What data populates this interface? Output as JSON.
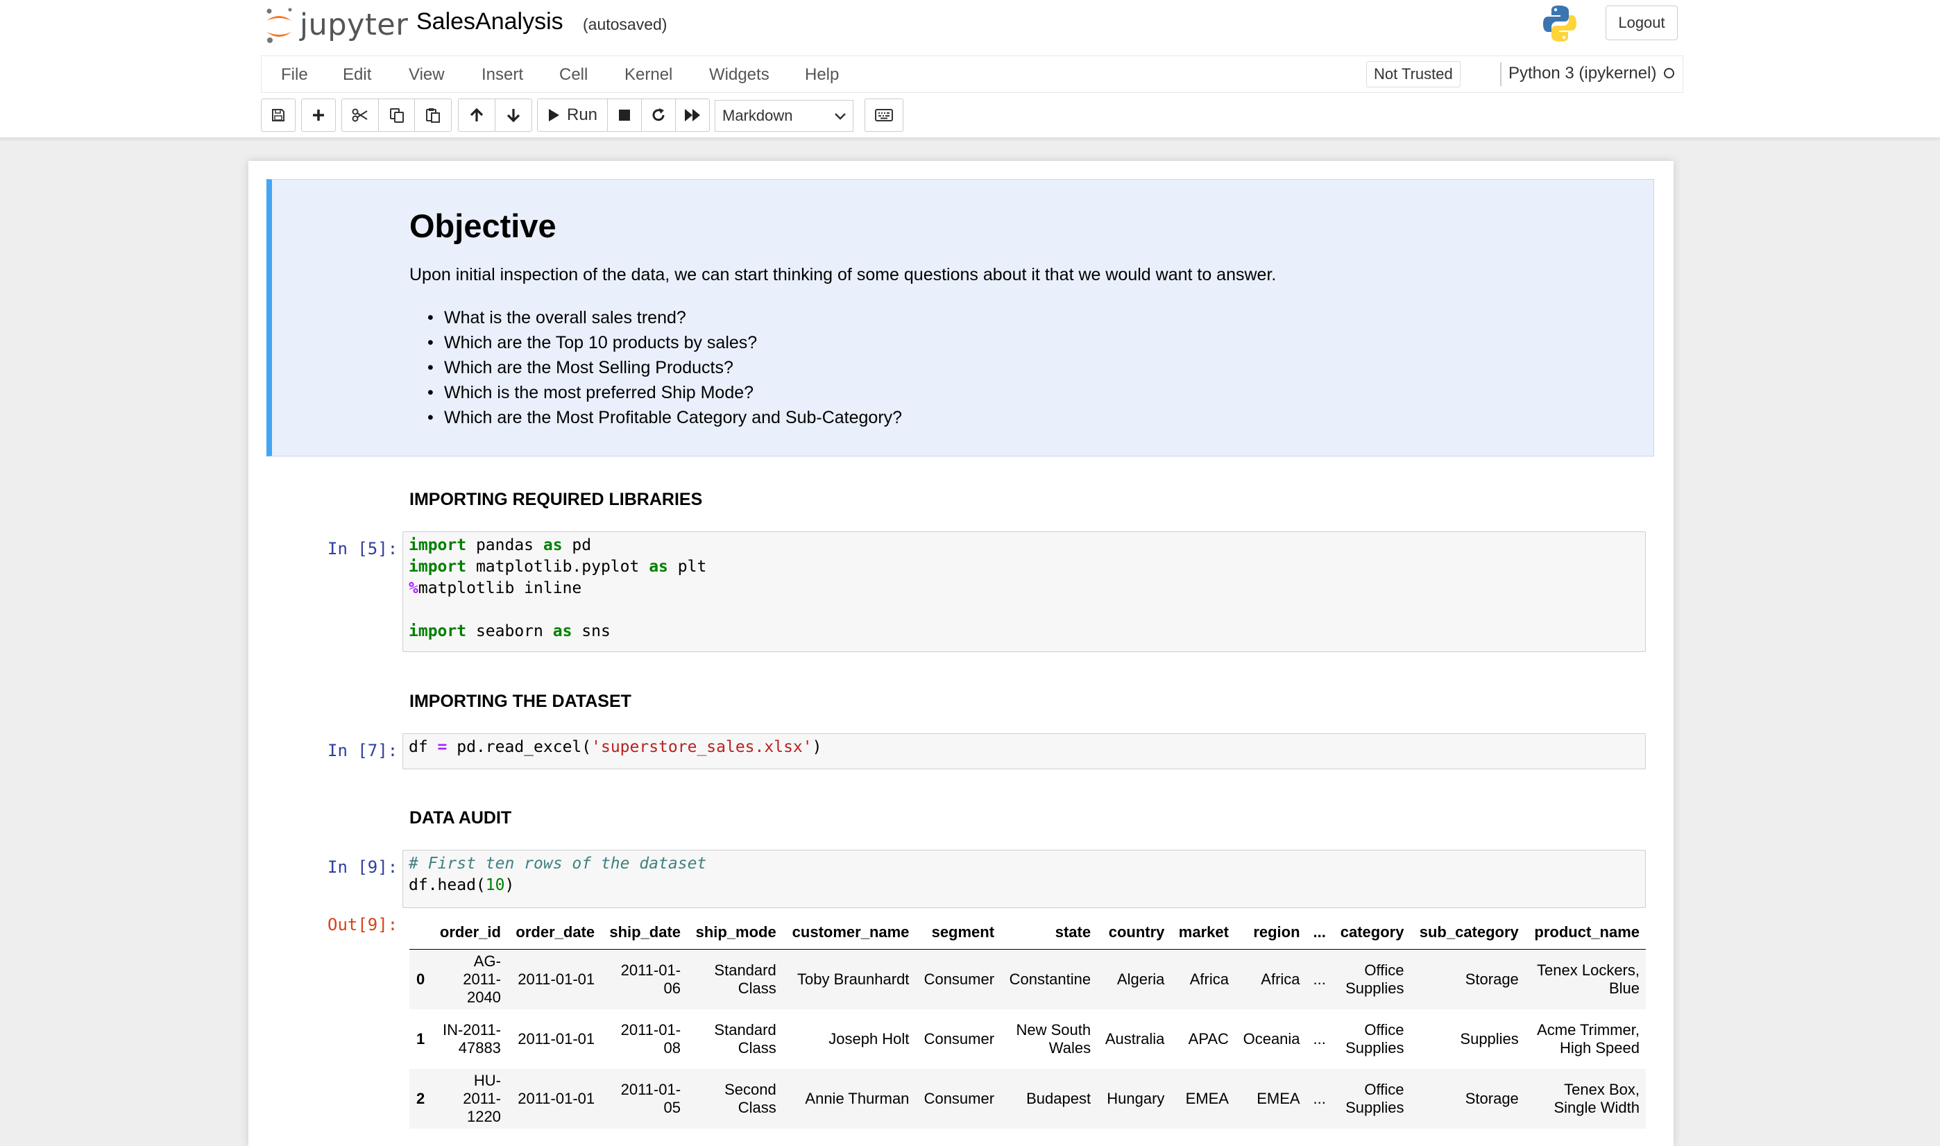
{
  "header": {
    "logo_text": "jupyter",
    "notebook_name": "SalesAnalysis",
    "autosave_status": "(autosaved)",
    "logout_label": "Logout"
  },
  "menu": [
    "File",
    "Edit",
    "View",
    "Insert",
    "Cell",
    "Kernel",
    "Widgets",
    "Help"
  ],
  "trust_status": "Not Trusted",
  "kernel_name": "Python 3 (ipykernel)",
  "toolbar": {
    "run_label": "Run",
    "cell_type": "Markdown",
    "icons": [
      "save-icon",
      "plus-icon",
      "cut-icon",
      "copy-icon",
      "paste-icon",
      "arrow-up-icon",
      "arrow-down-icon",
      "play-icon",
      "stop-icon",
      "restart-icon",
      "fast-forward-icon",
      "keyboard-icon"
    ]
  },
  "objective": {
    "title": "Objective",
    "intro": "Upon initial inspection of the data, we can start thinking of some questions about it that we would want to answer.",
    "questions": [
      "What is the overall sales trend?",
      "Which are the Top 10 products by sales?",
      "Which are the Most Selling Products?",
      "Which is the most preferred Ship Mode?",
      "Which are the Most Profitable Category and Sub-Category?"
    ]
  },
  "sections": {
    "libraries": "IMPORTING REQUIRED LIBRARIES",
    "dataset": "IMPORTING THE DATASET",
    "audit": "DATA AUDIT"
  },
  "cells": {
    "cell5": {
      "prompt": "In [5]:",
      "lines": [
        [
          {
            "t": "kw",
            "v": "import"
          },
          {
            "t": "",
            "v": " pandas "
          },
          {
            "t": "kw",
            "v": "as"
          },
          {
            "t": "",
            "v": " pd"
          }
        ],
        [
          {
            "t": "kw",
            "v": "import"
          },
          {
            "t": "",
            "v": " matplotlib.pyplot "
          },
          {
            "t": "kw",
            "v": "as"
          },
          {
            "t": "",
            "v": " plt"
          }
        ],
        [
          {
            "t": "op",
            "v": "%"
          },
          {
            "t": "",
            "v": "matplotlib inline"
          }
        ],
        [],
        [
          {
            "t": "kw",
            "v": "import"
          },
          {
            "t": "",
            "v": " seaborn "
          },
          {
            "t": "kw",
            "v": "as"
          },
          {
            "t": "",
            "v": " sns"
          }
        ]
      ]
    },
    "cell7": {
      "prompt": "In [7]:",
      "lines": [
        [
          {
            "t": "",
            "v": "df "
          },
          {
            "t": "op",
            "v": "="
          },
          {
            "t": "",
            "v": " pd.read_excel("
          },
          {
            "t": "str",
            "v": "'superstore_sales.xlsx'"
          },
          {
            "t": "",
            "v": ")"
          }
        ]
      ]
    },
    "cell9": {
      "prompt": "In [9]:",
      "out_prompt": "Out[9]:",
      "lines": [
        [
          {
            "t": "cm",
            "v": "# First ten rows of the dataset"
          }
        ],
        [
          {
            "t": "",
            "v": "df.head("
          },
          {
            "t": "num",
            "v": "10"
          },
          {
            "t": "",
            "v": ")"
          }
        ]
      ]
    }
  },
  "dataframe": {
    "columns": [
      "",
      "order_id",
      "order_date",
      "ship_date",
      "ship_mode",
      "customer_name",
      "segment",
      "state",
      "country",
      "market",
      "region",
      "...",
      "category",
      "sub_category",
      "product_name"
    ],
    "rows": [
      [
        "0",
        "AG-\n2011-\n2040",
        "2011-01-01",
        "2011-01-\n06",
        "Standard\nClass",
        "Toby Braunhardt",
        "Consumer",
        "Constantine",
        "Algeria",
        "Africa",
        "Africa",
        "...",
        "Office\nSupplies",
        "Storage",
        "Tenex Lockers,\nBlue"
      ],
      [
        "1",
        "IN-2011-\n47883",
        "2011-01-01",
        "2011-01-\n08",
        "Standard\nClass",
        "Joseph Holt",
        "Consumer",
        "New South\nWales",
        "Australia",
        "APAC",
        "Oceania",
        "...",
        "Office\nSupplies",
        "Supplies",
        "Acme Trimmer,\nHigh Speed"
      ],
      [
        "2",
        "HU-\n2011-\n1220",
        "2011-01-01",
        "2011-01-\n05",
        "Second\nClass",
        "Annie Thurman",
        "Consumer",
        "Budapest",
        "Hungary",
        "EMEA",
        "EMEA",
        "...",
        "Office\nSupplies",
        "Storage",
        "Tenex Box,\nSingle Width"
      ]
    ]
  },
  "colors": {
    "accent_border": "#42a5f5",
    "selected_cell_bg": "#e9f0fb",
    "prompt_in": "#303f9f",
    "prompt_out": "#d84315",
    "keyword": "#008000",
    "string": "#ba2121",
    "operator": "#aa22ff",
    "comment": "#408080"
  }
}
